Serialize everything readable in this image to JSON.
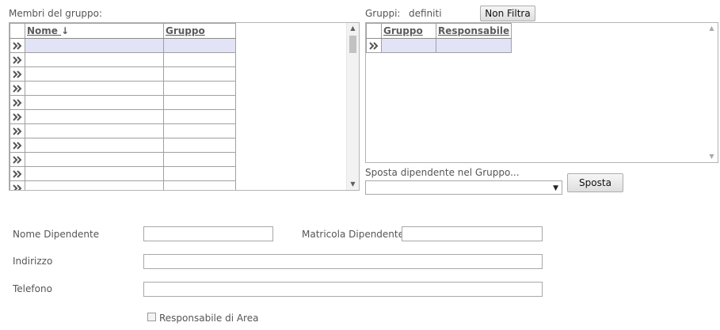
{
  "members": {
    "label": "Membri del gruppo:",
    "columns": {
      "name": "Nome",
      "sort_arrow": "↓",
      "group": "Gruppo"
    },
    "row_count": 11
  },
  "groups": {
    "label_prefix": "Gruppi:",
    "label_value": "definiti",
    "filter_button": "Non Filtra",
    "columns": {
      "group": "Gruppo",
      "manager": "Responsabile"
    }
  },
  "move": {
    "label": "Sposta dipendente nel Gruppo...",
    "select_value": "",
    "button": "Sposta"
  },
  "form": {
    "name_label": "Nome Dipendente",
    "name_value": "",
    "badge_label": "Matricola Dipendente",
    "badge_value": "",
    "address_label": "Indirizzo",
    "address_value": "",
    "phone_label": "Telefono",
    "phone_value": "",
    "area_manager_label": "Responsabile di Area"
  },
  "colors": {
    "selected_row": "#e3e3f7",
    "border": "#a0a0a0"
  },
  "icons": {
    "row_selector": "double-chevron-right-icon"
  }
}
